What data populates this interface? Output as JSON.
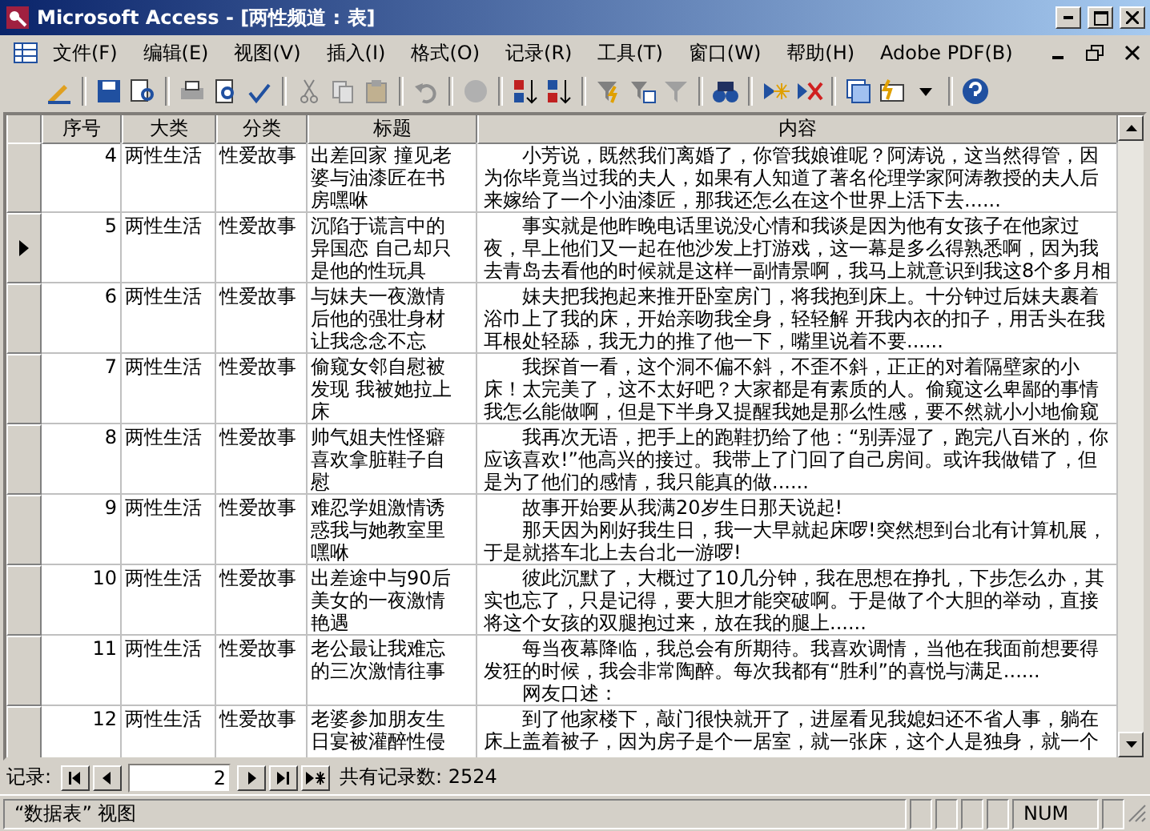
{
  "window": {
    "title": "Microsoft Access - [两性频道 : 表]"
  },
  "menu": [
    "文件(F)",
    "编辑(E)",
    "视图(V)",
    "插入(I)",
    "格式(O)",
    "记录(R)",
    "工具(T)",
    "窗口(W)",
    "帮助(H)",
    "Adobe PDF(B)"
  ],
  "table": {
    "columns": [
      "序号",
      "大类",
      "分类",
      "标题",
      "内容"
    ],
    "rows": [
      {
        "id": "4",
        "category": "两性生活",
        "subcategory": "性爱故事",
        "title": "出差回家 撞见老婆与油漆匠在书房嘿咻",
        "selected": false,
        "content": [
          {
            "text": "小芳说，既然我们离婚了，你管我娘谁呢？阿涛说，这当然得管，因",
            "indent": true
          },
          {
            "text": "为你毕竟当过我的夫人，如果有人知道了著名伦理学家阿涛教授的夫人后",
            "indent": false
          },
          {
            "text": "来嫁给了一个小油漆匠，那我还怎么在这个世界上活下去......",
            "indent": false
          }
        ]
      },
      {
        "id": "5",
        "category": "两性生活",
        "subcategory": "性爱故事",
        "title": "沉陷于谎言中的异国恋 自己却只是他的性玩具",
        "selected": true,
        "content": [
          {
            "text": "事实就是他昨晚电话里说没心情和我谈是因为他有女孩子在他家过",
            "indent": true
          },
          {
            "text": "夜，早上他们又一起在他沙发上打游戏，这一幕是多么得熟悉啊，因为我",
            "indent": false
          },
          {
            "text": "去青岛去看他的时候就是这样一副情景啊，我马上就意识到我这8个多月相",
            "indent": false
          }
        ]
      },
      {
        "id": "6",
        "category": "两性生活",
        "subcategory": "性爱故事",
        "title": "与妹夫一夜激情后他的强壮身材让我念念不忘",
        "selected": false,
        "content": [
          {
            "text": "妹夫把我抱起来推开卧室房门，将我抱到床上。十分钟过后妹夫裹着",
            "indent": true
          },
          {
            "text": "浴巾上了我的床，开始亲吻我全身，轻轻解 开我内衣的扣子，用舌头在我",
            "indent": false
          },
          {
            "text": "耳根处轻舔，我无力的推了他一下，嘴里说着不要......",
            "indent": false
          }
        ]
      },
      {
        "id": "7",
        "category": "两性生活",
        "subcategory": "性爱故事",
        "title": "偷窥女邻自慰被发现 我被她拉上床",
        "selected": false,
        "content": [
          {
            "text": "我探首一看，这个洞不偏不斜，不歪不斜，正正的对着隔壁家的小",
            "indent": true
          },
          {
            "text": "床！太完美了，这不太好吧？大家都是有素质的人。偷窥这么卑鄙的事情",
            "indent": false
          },
          {
            "text": "我怎么能做啊，但是下半身又提醒我她是那么性感，要不然就小小地偷窥",
            "indent": false
          }
        ]
      },
      {
        "id": "8",
        "category": "两性生活",
        "subcategory": "性爱故事",
        "title": "帅气姐夫性怪癖喜欢拿脏鞋子自慰",
        "selected": false,
        "content": [
          {
            "text": "我再次无语，把手上的跑鞋扔给了他：“别弄湿了，跑完八百米的，你",
            "indent": true
          },
          {
            "text": "应该喜欢!”他高兴的接过。我带上了门回了自己房间。或许我做错了，但",
            "indent": false
          },
          {
            "text": "是为了他们的感情，我只能真的做......",
            "indent": false
          }
        ]
      },
      {
        "id": "9",
        "category": "两性生活",
        "subcategory": "性爱故事",
        "title": "难忍学姐激情诱惑我与她教室里嘿咻",
        "selected": false,
        "content": [
          {
            "text": "故事开始要从我满20岁生日那天说起!",
            "indent": true
          },
          {
            "text": "那天因为刚好我生日，我一大早就起床啰!突然想到台北有计算机展，",
            "indent": true
          },
          {
            "text": "于是就搭车北上去台北一游啰!",
            "indent": false
          }
        ]
      },
      {
        "id": "10",
        "category": "两性生活",
        "subcategory": "性爱故事",
        "title": "出差途中与90后美女的一夜激情艳遇",
        "selected": false,
        "content": [
          {
            "text": "彼此沉默了，大概过了10几分钟，我在思想在挣扎，下步怎么办，其",
            "indent": true
          },
          {
            "text": "实也忘了，只是记得，要大胆才能突破啊。于是做了个大胆的举动，直接",
            "indent": false
          },
          {
            "text": "将这个女孩的双腿抱过来，放在我的腿上......",
            "indent": false
          }
        ]
      },
      {
        "id": "11",
        "category": "两性生活",
        "subcategory": "性爱故事",
        "title": "老公最让我难忘的三次激情往事",
        "selected": false,
        "content": [
          {
            "text": "每当夜幕降临，我总会有所期待。我喜欢调情，当他在我面前想要得",
            "indent": true
          },
          {
            "text": "发狂的时候，我会非常陶醉。每次我都有“胜利”的喜悦与满足......",
            "indent": false
          },
          {
            "text": "网友口述：",
            "indent": true
          }
        ]
      },
      {
        "id": "12",
        "category": "两性生活",
        "subcategory": "性爱故事",
        "title": "老婆参加朋友生日宴被灌醉性侵",
        "selected": false,
        "content": [
          {
            "text": "到了他家楼下，敲门很快就开了，进屋看见我媳妇还不省人事，躺在",
            "indent": true
          },
          {
            "text": "床上盖着被子，因为房子是个一居室，就一张床，这个人是独身，就一个",
            "indent": false
          }
        ]
      }
    ]
  },
  "record_nav": {
    "label": "记录:",
    "current": "2",
    "total": "共有记录数: 2524"
  },
  "status_bar": {
    "view": "“数据表” 视图",
    "num": "NUM"
  }
}
